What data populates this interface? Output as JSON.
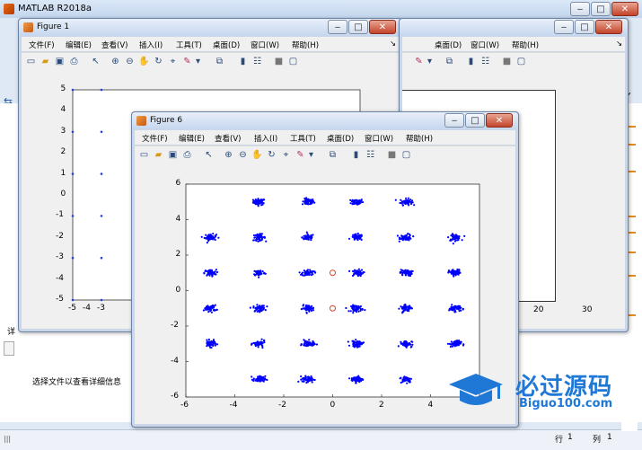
{
  "matlab": {
    "title": "MATLAB R2018a",
    "menu_right": [
      "桌面(D)",
      "窗口(W)",
      "帮助(H)"
    ],
    "detail_text": "选择文件以查看详细信息",
    "status": {
      "row_label": "行",
      "row_value": "1",
      "col_label": "列",
      "col_value": "1"
    }
  },
  "figure1": {
    "title": "Figure 1",
    "menus": [
      "文件(F)",
      "编辑(E)",
      "查看(V)",
      "插入(I)",
      "工具(T)",
      "桌面(D)",
      "窗口(W)",
      "帮助(H)"
    ],
    "y_ticks": [
      "5",
      "4",
      "3",
      "2",
      "1",
      "0",
      "-1",
      "-2",
      "-3",
      "-4",
      "-5"
    ],
    "x_ticks_left": [
      "-5",
      "-4",
      "-3"
    ],
    "x_ticks_right": [
      "20",
      "30"
    ]
  },
  "figure6": {
    "title": "Figure 6",
    "menus": [
      "文件(F)",
      "编辑(E)",
      "查看(V)",
      "插入(I)",
      "工具(T)",
      "桌面(D)",
      "窗口(W)",
      "帮助(H)"
    ]
  },
  "toolbar_icons": [
    "new-file-icon",
    "open-folder-icon",
    "save-icon",
    "print-icon",
    "pointer-icon",
    "zoom-in-icon",
    "zoom-out-icon",
    "pan-hand-icon",
    "rotate-3d-icon",
    "data-cursor-icon",
    "brush-icon",
    "link-plot-icon",
    "colorbar-icon",
    "legend-icon",
    "hide-plot-tools-icon",
    "show-plot-tools-icon"
  ],
  "chart_data": [
    {
      "type": "scatter",
      "title": "",
      "xlabel": "",
      "ylabel": "",
      "xlim": [
        -6,
        6
      ],
      "ylim": [
        -6,
        6
      ],
      "x_ticks": [
        -6,
        -4,
        -2,
        0,
        2,
        4
      ],
      "y_ticks": [
        -6,
        -4,
        -2,
        0,
        2,
        4,
        6
      ],
      "grid": false,
      "series": [
        {
          "marker_color": "#0000ff",
          "cluster_centers": [
            [
              -3,
              5
            ],
            [
              -1,
              5
            ],
            [
              1,
              5
            ],
            [
              3,
              5
            ],
            [
              -5,
              3
            ],
            [
              -3,
              3
            ],
            [
              -1,
              3
            ],
            [
              1,
              3
            ],
            [
              3,
              3
            ],
            [
              5,
              3
            ],
            [
              -5,
              1
            ],
            [
              -3,
              1
            ],
            [
              -1,
              1
            ],
            [
              1,
              1
            ],
            [
              3,
              1
            ],
            [
              5,
              1
            ],
            [
              -5,
              -1
            ],
            [
              -3,
              -1
            ],
            [
              -1,
              -1
            ],
            [
              1,
              -1
            ],
            [
              3,
              -1
            ],
            [
              5,
              -1
            ],
            [
              -5,
              -3
            ],
            [
              -3,
              -3
            ],
            [
              -1,
              -3
            ],
            [
              1,
              -3
            ],
            [
              3,
              -3
            ],
            [
              5,
              -3
            ],
            [
              -3,
              -5
            ],
            [
              -1,
              -5
            ],
            [
              1,
              -5
            ],
            [
              3,
              -5
            ]
          ],
          "spread": 0.22
        },
        {
          "marker": "circle",
          "marker_color": "#d9442b",
          "points": [
            [
              0,
              1
            ],
            [
              0,
              -1
            ]
          ]
        }
      ]
    },
    {
      "type": "scatter",
      "xlim": [
        -5,
        5
      ],
      "ylim": [
        -5,
        5
      ],
      "series": [
        {
          "marker_color": "#2a3fd4",
          "points": [
            [
              -5,
              5
            ],
            [
              -3,
              5
            ],
            [
              -5,
              3
            ],
            [
              -3,
              3
            ],
            [
              -5,
              1
            ],
            [
              -3,
              1
            ],
            [
              -5,
              -1
            ],
            [
              -3,
              -1
            ],
            [
              -5,
              -3
            ],
            [
              -3,
              -3
            ],
            [
              -5,
              -5
            ],
            [
              -3,
              -5
            ]
          ]
        }
      ]
    }
  ]
}
